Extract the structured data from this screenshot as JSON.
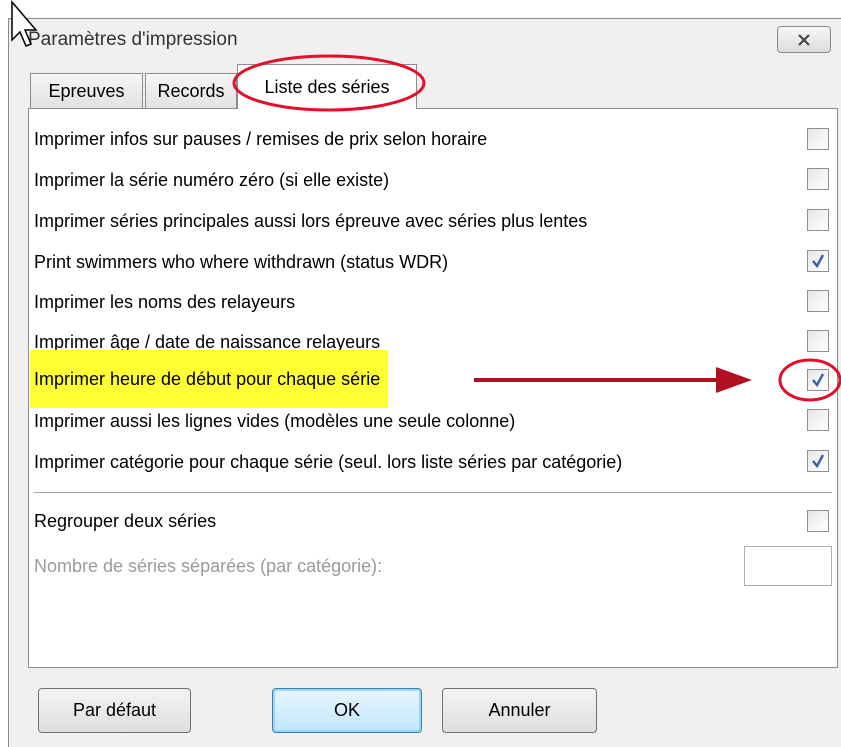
{
  "dialog": {
    "title": "Paramètres d'impression"
  },
  "tabs": [
    {
      "label": "Epreuves"
    },
    {
      "label": "Records"
    },
    {
      "label": "Liste des séries",
      "active": true
    }
  ],
  "options": [
    {
      "label": "Imprimer infos sur pauses / remises de prix selon horaire",
      "checked": false
    },
    {
      "label": "Imprimer la série numéro zéro (si elle existe)",
      "checked": false
    },
    {
      "label": "Imprimer séries principales aussi lors épreuve avec séries plus lentes",
      "checked": false
    },
    {
      "label": "Print swimmers who where withdrawn (status WDR)",
      "checked": true
    },
    {
      "label": "Imprimer les noms des relayeurs",
      "checked": false
    },
    {
      "label": "Imprimer âge / date de naissance relayeurs",
      "checked": false
    },
    {
      "label": "Imprimer heure de début pour chaque série",
      "checked": true,
      "highlighted": true
    },
    {
      "label": "Imprimer aussi les lignes vides (modèles une seule colonne)",
      "checked": false
    },
    {
      "label": "Imprimer catégorie pour chaque série (seul. lors liste séries par catégorie)",
      "checked": true
    }
  ],
  "group": {
    "label": "Regrouper deux séries",
    "checked": false,
    "count_label": "Nombre de séries séparées (par catégorie):",
    "count_value": ""
  },
  "buttons": {
    "default_label": "Par défaut",
    "ok_label": "OK",
    "cancel_label": "Annuler"
  },
  "colors": {
    "highlight": "#ffff33",
    "annotation_red": "#e0102a",
    "arrow_red": "#b01020",
    "check_blue": "#3a5fa8"
  }
}
